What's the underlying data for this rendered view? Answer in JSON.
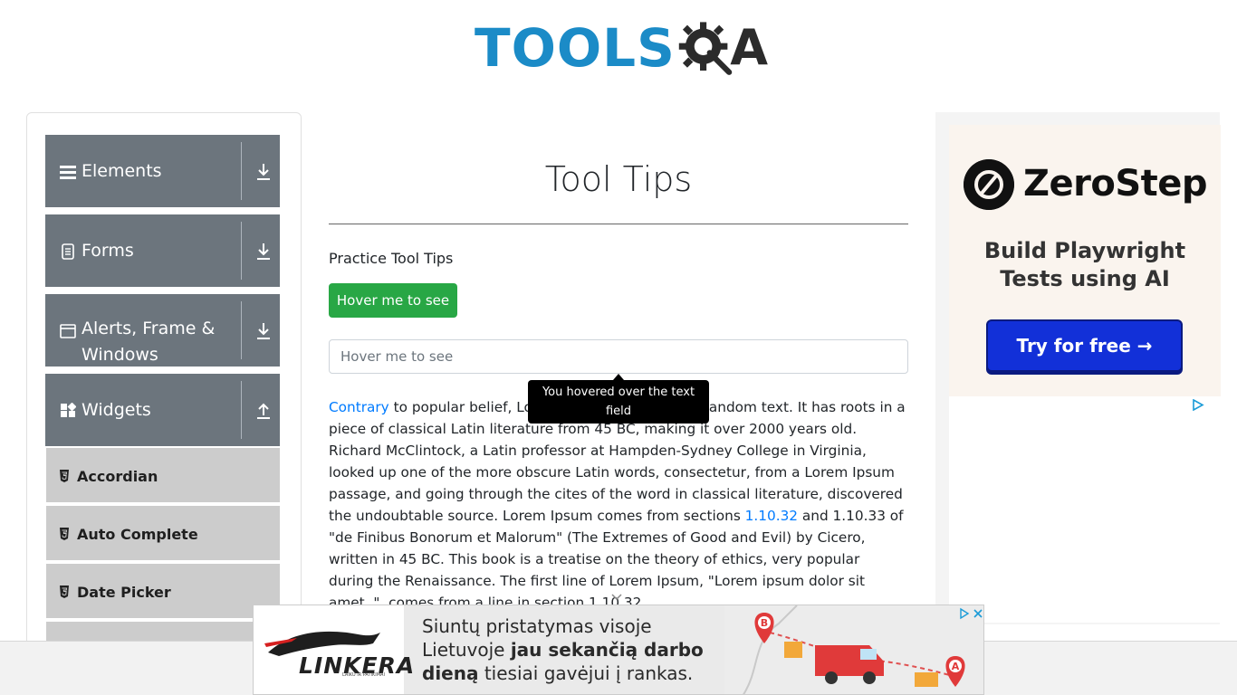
{
  "header": {
    "logo_text": "TOOLS",
    "logo_suffix": "A"
  },
  "sidebar": {
    "groups": [
      {
        "label": "Elements",
        "icon": "hamburger-icon",
        "arrow": "download-arrow-icon"
      },
      {
        "label": "Forms",
        "icon": "document-icon",
        "arrow": "download-arrow-icon"
      },
      {
        "label": "Alerts, Frame & Windows",
        "icon": "window-icon",
        "arrow": "download-arrow-icon"
      },
      {
        "label": "Widgets",
        "icon": "widgets-icon",
        "arrow": "upload-arrow-icon"
      }
    ],
    "widget_items": [
      {
        "label": "Accordian",
        "icon": "html5-icon"
      },
      {
        "label": "Auto Complete",
        "icon": "html5-icon"
      },
      {
        "label": "Date Picker",
        "icon": "html5-icon"
      }
    ]
  },
  "main": {
    "title": "Tool Tips",
    "practice_label": "Practice Tool Tips",
    "hover_button_label": "Hover me to see",
    "hover_input_placeholder": "Hover me to see",
    "tooltip_text": "You hovered over the text field",
    "paragraph": {
      "link1": "Contrary",
      "part1": " to popular belief, Lorem Ipsum is not simply random text. It has roots in a piece of classical Latin literature from 45 BC, making it over 2000 years old. Richard McClintock, a Latin professor at Hampden-Sydney College in Virginia, looked up one of the more obscure Latin words, consectetur, from a Lorem Ipsum passage, and going through the cites of the word in classical literature, discovered the undoubtable source. Lorem Ipsum comes from sections ",
      "link2": "1.10.32",
      "part2": " and 1.10.33 of \"de Finibus Bonorum et Malorum\" (The Extremes of Good and Evil) by Cicero, written in 45 BC. This book is a treatise on the theory of ethics, very popular during the Renaissance. The first line of Lorem Ipsum, \"Lorem ipsum dolor sit amet..\", comes from a line in section 1.10.32."
    }
  },
  "right_ad": {
    "brand": "ZeroStep",
    "headline": "Build Playwright Tests using AI",
    "cta": "Try for free →"
  },
  "bottom_ad": {
    "brand": "LINKERA",
    "tagline": "LAIKU IR PATIKIMAI",
    "text_plain1": "Siuntų pristatymas visoje Lietuvoje ",
    "text_bold": "jau sekančią darbo dieną",
    "text_plain2": " tiesiai gavėjui į rankas.",
    "marker_b": "B",
    "marker_a": "A"
  }
}
